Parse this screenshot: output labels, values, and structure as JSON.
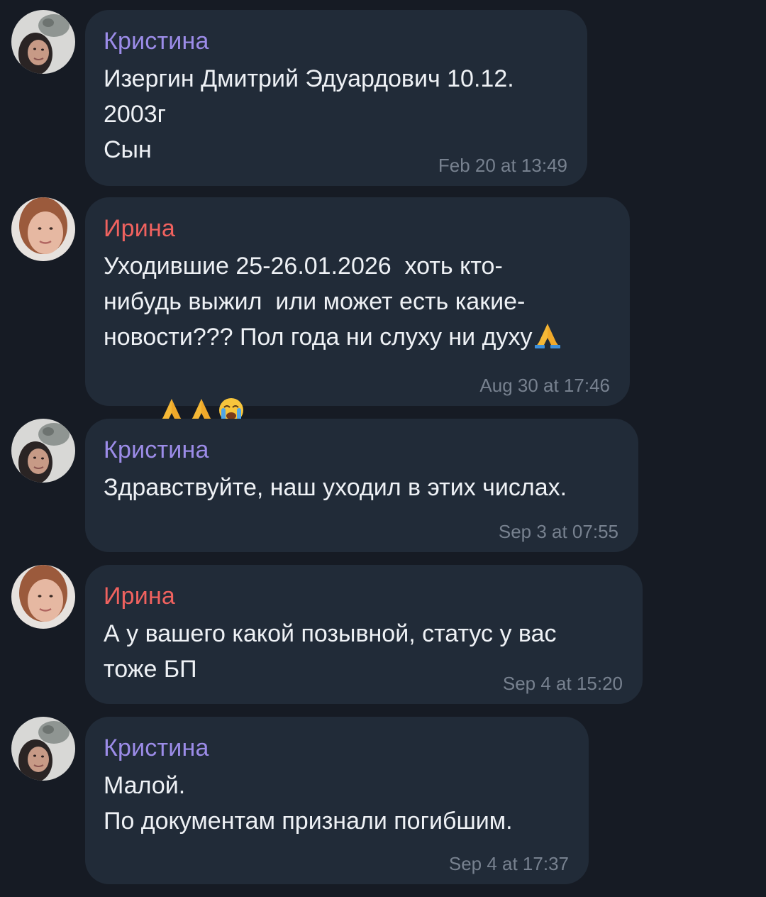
{
  "colors": {
    "background": "#161b24",
    "bubble": "#212b38",
    "kristina_name": "#9c8ce8",
    "irina_name": "#f0625f",
    "text": "#eef1f5",
    "time": "#77818f"
  },
  "messages": [
    {
      "sender": "Кристина",
      "text": "Изергин Дмитрий Эдуардович 10.12.\n2003г\nСын",
      "time": "Feb 20 at 13:49"
    },
    {
      "sender": "Ирина",
      "text_lines": [
        "Уходившие 25-26.01.2026  хоть кто-",
        "нибудь выжил  или может есть какие-",
        "новости??? Пол года ни слуху ни духу"
      ],
      "emojis": [
        "folded-hands",
        "folded-hands",
        "folded-hands",
        "loudly-crying-face"
      ],
      "time": "Aug 30 at 17:46"
    },
    {
      "sender": "Кристина",
      "text": "Здравствуйте, наш уходил в этих числах.",
      "time": "Sep 3 at 07:55"
    },
    {
      "sender": "Ирина",
      "text": "А у вашего какой позывной, статус у вас\nтоже БП",
      "time": "Sep 4 at 15:20"
    },
    {
      "sender": "Кристина",
      "text": "Малой.\nПо документам признали погибшим.",
      "time": "Sep 4 at 17:37"
    }
  ]
}
